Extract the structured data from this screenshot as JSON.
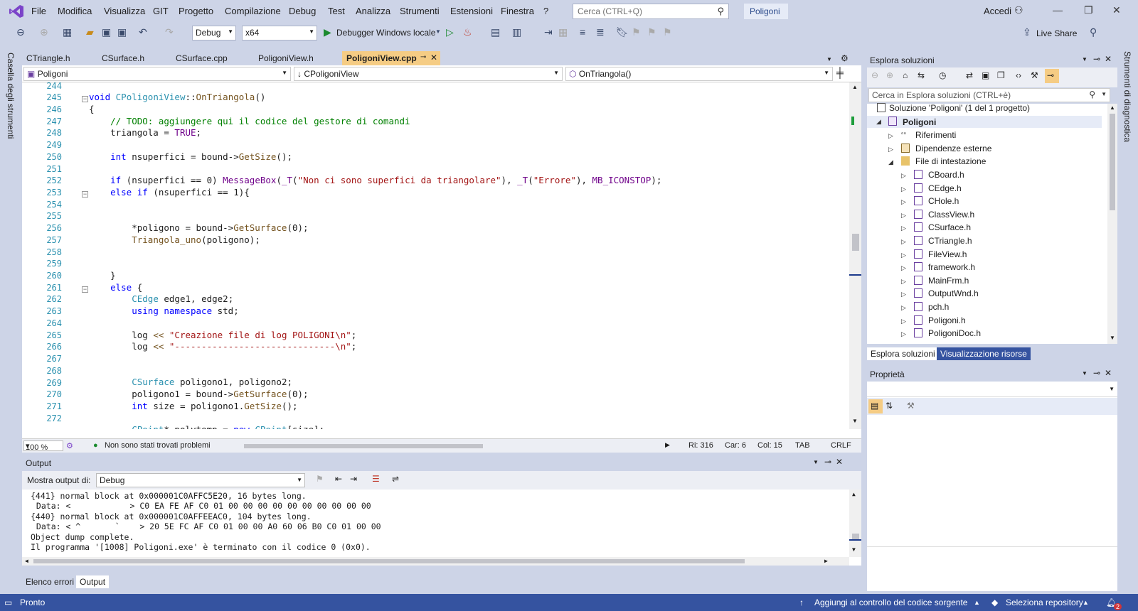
{
  "menubar": {
    "items": [
      "File",
      "Modifica",
      "Visualizza",
      "GIT",
      "Progetto",
      "Compilazione",
      "Debug",
      "Test",
      "Analizza",
      "Strumenti",
      "Estensioni",
      "Finestra",
      "?"
    ],
    "search_placeholder": "Cerca (CTRL+Q)",
    "solution_name": "Poligoni",
    "signin": "Accedi"
  },
  "toolbar": {
    "config": "Debug",
    "platform": "x64",
    "debugger": "Debugger Windows locale",
    "liveshare": "Live Share"
  },
  "left_strip": {
    "label": "Casella degli strumenti"
  },
  "right_strip": {
    "label": "Strumenti di diagnostica"
  },
  "doc_tabs": [
    {
      "label": "CTriangle.h"
    },
    {
      "label": "CSurface.h"
    },
    {
      "label": "CSurface.cpp"
    },
    {
      "label": "PoligoniView.h"
    },
    {
      "label": "PoligoniView.cpp"
    }
  ],
  "navbar": {
    "project": "Poligoni",
    "scope": "CPoligoniView",
    "member": "OnTriangola()"
  },
  "editor": {
    "line_numbers": [
      "244",
      "245",
      "246",
      "247",
      "248",
      "249",
      "250",
      "251",
      "252",
      "253",
      "254",
      "255",
      "256",
      "257",
      "258",
      "259",
      "260",
      "261",
      "262",
      "263",
      "264",
      "265",
      "266",
      "267",
      "268",
      "269",
      "270",
      "271",
      "272"
    ],
    "zoom": "100 %",
    "problems": "Non sono stati trovati problemi",
    "pos_row": "Ri: 316",
    "pos_char": "Car: 6",
    "pos_col": "Col: 15",
    "indent": "TAB",
    "line_ending": "CRLF"
  },
  "output": {
    "title": "Output",
    "show_label": "Mostra output di:",
    "source": "Debug",
    "lines": [
      "{441} normal block at 0x000001C0AFFC5E20, 16 bytes long.",
      " Data: <            > C0 EA FE AF C0 01 00 00 00 00 00 00 00 00 00 00",
      "{440} normal block at 0x000001C0AFFEEAC0, 104 bytes long.",
      " Data: < ^       `    > 20 5E FC AF C0 01 00 00 A0 60 06 B0 C0 01 00 00",
      "Object dump complete.",
      "Il programma '[1008] Poligoni.exe' è terminato con il codice 0 (0x0)."
    ],
    "tabs": [
      "Elenco errori",
      "Output"
    ]
  },
  "solution_explorer": {
    "title": "Esplora soluzioni",
    "search_placeholder": "Cerca in Esplora soluzioni (CTRL+è)",
    "solution": "Soluzione 'Poligoni' (1 del 1 progetto)",
    "project": "Poligoni",
    "folders": [
      "Riferimenti",
      "Dipendenze esterne",
      "File di intestazione"
    ],
    "headers": [
      "CBoard.h",
      "CEdge.h",
      "CHole.h",
      "ClassView.h",
      "CSurface.h",
      "CTriangle.h",
      "FileView.h",
      "framework.h",
      "MainFrm.h",
      "OutputWnd.h",
      "pch.h",
      "Poligoni.h",
      "PoligoniDoc.h"
    ],
    "tabs": [
      "Esplora soluzioni",
      "Visualizzazione risorse"
    ]
  },
  "properties": {
    "title": "Proprietà"
  },
  "statusbar": {
    "ready": "Pronto",
    "source_control": "Aggiungi al controllo del codice sorgente",
    "repo": "Seleziona repository",
    "notifications": "2"
  }
}
